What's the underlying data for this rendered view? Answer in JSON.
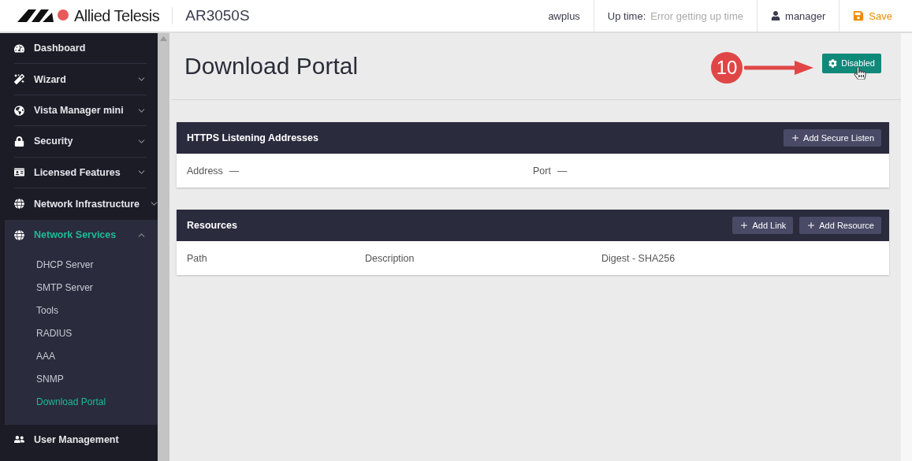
{
  "header": {
    "brand": "Allied Telesis",
    "device": "AR3050S",
    "hostname": "awplus",
    "uptime_label": "Up time:",
    "uptime_value": "Error getting up time",
    "user": "manager",
    "save": "Save"
  },
  "sidebar": {
    "items": [
      {
        "label": "Dashboard",
        "expandable": false,
        "expanded": false,
        "selected": false
      },
      {
        "label": "Wizard",
        "expandable": true,
        "expanded": false,
        "selected": false
      },
      {
        "label": "Vista Manager mini",
        "expandable": true,
        "expanded": false,
        "selected": false
      },
      {
        "label": "Security",
        "expandable": true,
        "expanded": false,
        "selected": false
      },
      {
        "label": "Licensed Features",
        "expandable": true,
        "expanded": false,
        "selected": false
      },
      {
        "label": "Network Infrastructure",
        "expandable": true,
        "expanded": false,
        "selected": false
      },
      {
        "label": "Network Services",
        "expandable": true,
        "expanded": true,
        "selected": true,
        "children": [
          {
            "label": "DHCP Server",
            "selected": false
          },
          {
            "label": "SMTP Server",
            "selected": false
          },
          {
            "label": "Tools",
            "selected": false
          },
          {
            "label": "RADIUS",
            "selected": false
          },
          {
            "label": "AAA",
            "selected": false
          },
          {
            "label": "SNMP",
            "selected": false
          },
          {
            "label": "Download Portal",
            "selected": true
          }
        ]
      },
      {
        "label": "User Management",
        "expandable": false,
        "expanded": false,
        "selected": false
      }
    ]
  },
  "page": {
    "title": "Download Portal",
    "status_button": "Disabled",
    "annotation": "10"
  },
  "panels": [
    {
      "title": "HTTPS Listening Addresses",
      "buttons": [
        "Add Secure Listen"
      ],
      "fields": [
        {
          "label": "Address",
          "value": "—"
        },
        {
          "label": "Port",
          "value": "—"
        }
      ]
    },
    {
      "title": "Resources",
      "buttons": [
        "Add Link",
        "Add Resource"
      ],
      "columns": [
        "Path",
        "Description",
        "Digest - SHA256"
      ]
    }
  ]
}
